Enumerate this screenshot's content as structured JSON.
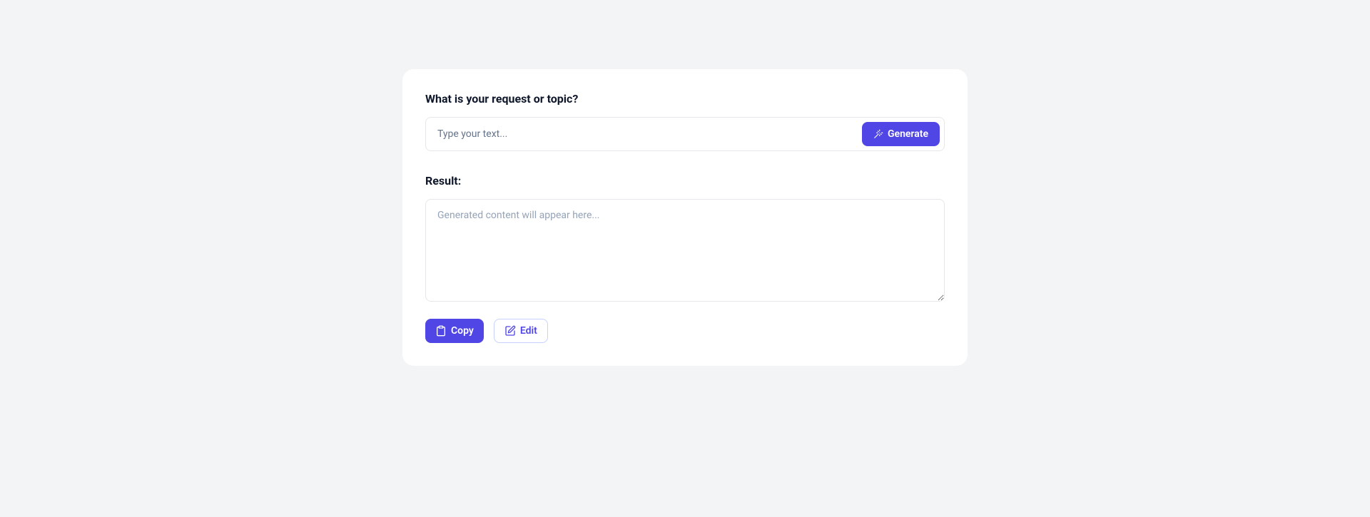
{
  "form": {
    "prompt_label": "What is your request or topic?",
    "input_placeholder": "Type your text...",
    "input_value": "",
    "generate_label": "Generate"
  },
  "result": {
    "label": "Result:",
    "placeholder": "Generated content will appear here...",
    "value": ""
  },
  "actions": {
    "copy_label": "Copy",
    "edit_label": "Edit"
  }
}
